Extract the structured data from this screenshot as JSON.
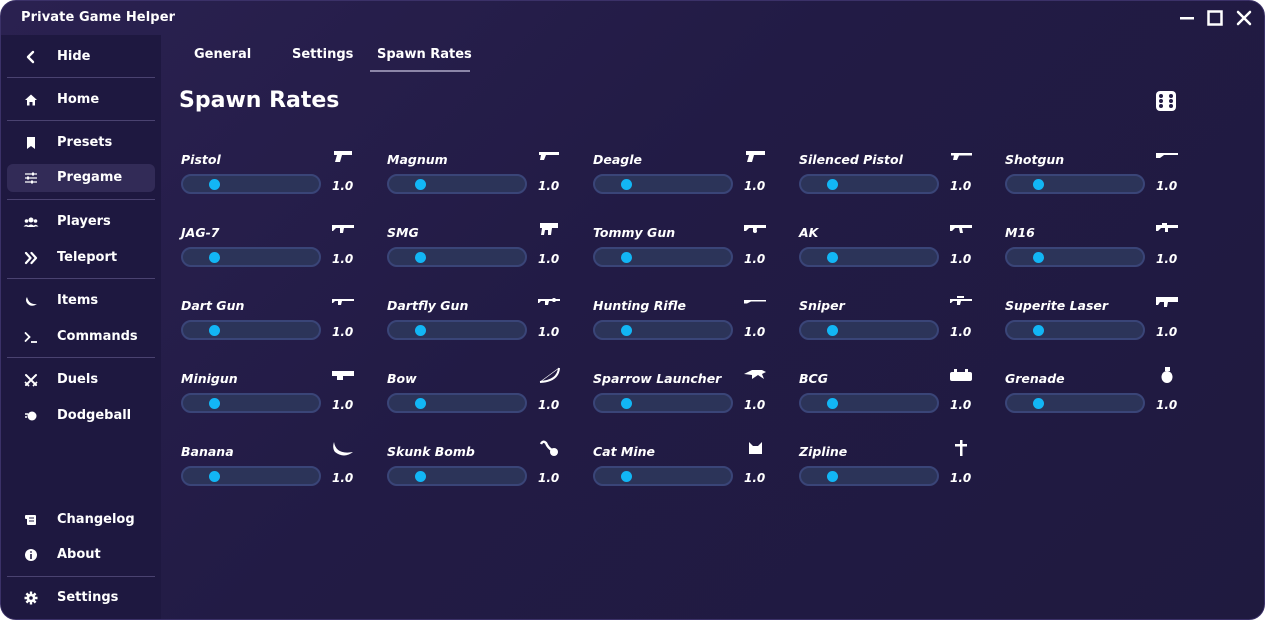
{
  "app": {
    "title": "Private Game Helper"
  },
  "window_controls": [
    "minimize-icon",
    "maximize-icon",
    "close-icon"
  ],
  "sidebar": {
    "items": [
      {
        "key": "hide",
        "label": "Hide",
        "icon": "chevron-left-icon"
      },
      {
        "key": "home",
        "label": "Home",
        "icon": "home-icon"
      },
      {
        "key": "presets",
        "label": "Presets",
        "icon": "bookmark-icon"
      },
      {
        "key": "pregame",
        "label": "Pregame",
        "icon": "sliders-icon",
        "active": true
      },
      {
        "key": "players",
        "label": "Players",
        "icon": "users-icon"
      },
      {
        "key": "teleport",
        "label": "Teleport",
        "icon": "double-chevron-right-icon"
      },
      {
        "key": "items",
        "label": "Items",
        "icon": "moon-icon"
      },
      {
        "key": "commands",
        "label": "Commands",
        "icon": "terminal-icon"
      },
      {
        "key": "duels",
        "label": "Duels",
        "icon": "crossed-swords-icon"
      },
      {
        "key": "dodgeball",
        "label": "Dodgeball",
        "icon": "ball-icon"
      },
      {
        "key": "changelog",
        "label": "Changelog",
        "icon": "scroll-icon"
      },
      {
        "key": "about",
        "label": "About",
        "icon": "info-icon"
      },
      {
        "key": "settings",
        "label": "Settings",
        "icon": "gear-icon"
      }
    ]
  },
  "tabs": [
    {
      "label": "General"
    },
    {
      "label": "Settings"
    },
    {
      "label": "Spawn Rates",
      "active": true
    }
  ],
  "page": {
    "title": "Spawn Rates",
    "randomize_icon": "dice-icon"
  },
  "accent_color": "#12b6f5",
  "weapons": [
    {
      "name": "Pistol",
      "value": "1.0",
      "icon": "pistol-icon"
    },
    {
      "name": "Magnum",
      "value": "1.0",
      "icon": "magnum-icon"
    },
    {
      "name": "Deagle",
      "value": "1.0",
      "icon": "deagle-icon"
    },
    {
      "name": "Silenced Pistol",
      "value": "1.0",
      "icon": "silenced-pistol-icon"
    },
    {
      "name": "Shotgun",
      "value": "1.0",
      "icon": "shotgun-icon"
    },
    {
      "name": "JAG-7",
      "value": "1.0",
      "icon": "jag7-icon"
    },
    {
      "name": "SMG",
      "value": "1.0",
      "icon": "smg-icon"
    },
    {
      "name": "Tommy Gun",
      "value": "1.0",
      "icon": "tommy-gun-icon"
    },
    {
      "name": "AK",
      "value": "1.0",
      "icon": "ak-icon"
    },
    {
      "name": "M16",
      "value": "1.0",
      "icon": "m16-icon"
    },
    {
      "name": "Dart Gun",
      "value": "1.0",
      "icon": "dart-gun-icon"
    },
    {
      "name": "Dartfly Gun",
      "value": "1.0",
      "icon": "dartfly-gun-icon"
    },
    {
      "name": "Hunting Rifle",
      "value": "1.0",
      "icon": "hunting-rifle-icon"
    },
    {
      "name": "Sniper",
      "value": "1.0",
      "icon": "sniper-icon"
    },
    {
      "name": "Superite Laser",
      "value": "1.0",
      "icon": "superite-laser-icon"
    },
    {
      "name": "Minigun",
      "value": "1.0",
      "icon": "minigun-icon"
    },
    {
      "name": "Bow",
      "value": "1.0",
      "icon": "bow-icon"
    },
    {
      "name": "Sparrow Launcher",
      "value": "1.0",
      "icon": "sparrow-launcher-icon"
    },
    {
      "name": "BCG",
      "value": "1.0",
      "icon": "bcg-icon"
    },
    {
      "name": "Grenade",
      "value": "1.0",
      "icon": "grenade-icon"
    },
    {
      "name": "Banana",
      "value": "1.0",
      "icon": "banana-icon"
    },
    {
      "name": "Skunk Bomb",
      "value": "1.0",
      "icon": "skunk-bomb-icon"
    },
    {
      "name": "Cat Mine",
      "value": "1.0",
      "icon": "cat-mine-icon"
    },
    {
      "name": "Zipline",
      "value": "1.0",
      "icon": "zipline-icon"
    }
  ]
}
